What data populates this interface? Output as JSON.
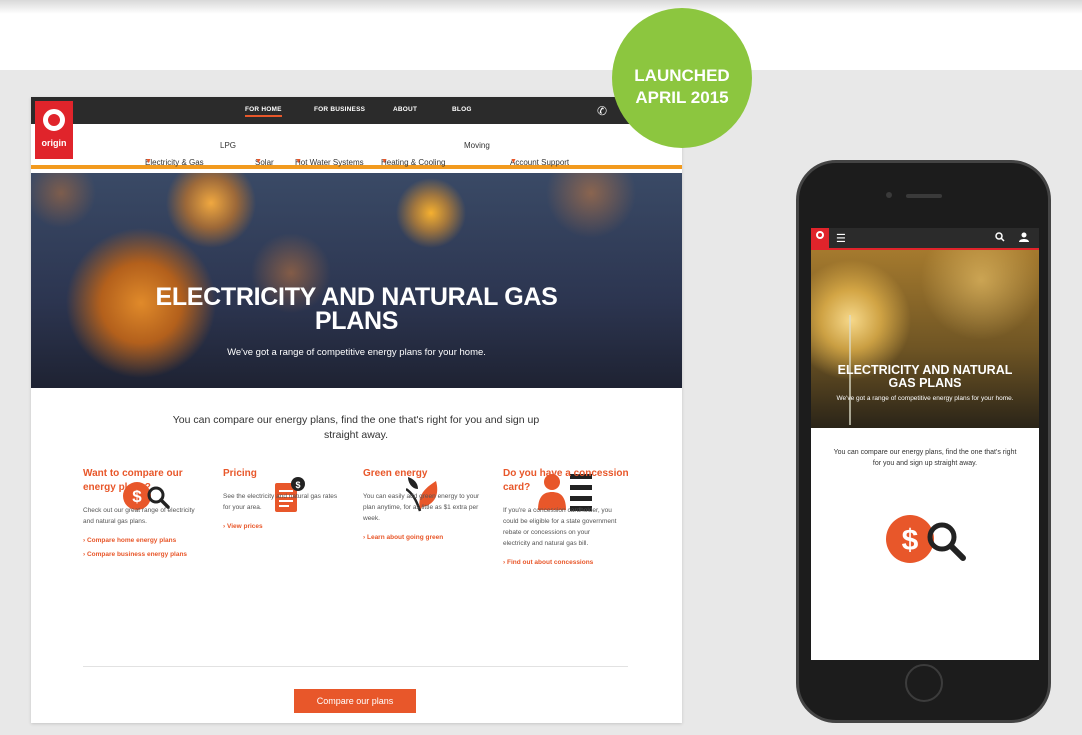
{
  "badge": {
    "line1": "LAUNCHED",
    "line2": "APRIL 2015"
  },
  "desktop": {
    "utility_nav": [
      "FOR HOME",
      "FOR BUSINESS",
      "ABOUT",
      "BLOG"
    ],
    "logo_text": "origin",
    "main_nav": [
      "Electricity & Gas",
      "LPG",
      "Solar",
      "Hot Water Systems",
      "Heating & Cooling",
      "Moving",
      "Account Support"
    ],
    "hero": {
      "title_line1": "ELECTRICITY AND NATURAL GAS",
      "title_line2": "PLANS",
      "subtitle": "We've got a range of competitive energy plans for your home."
    },
    "intro_line1": "You can compare our energy plans, find the one that's right for you and sign up",
    "intro_line2": "straight away.",
    "features": [
      {
        "icon": "dollar-search-icon",
        "title_line1": "Want to compare our",
        "title_line2": "energy plans?",
        "text_line1": "Check out our great range of electricity",
        "text_line2": "and natural gas plans.",
        "links": [
          "Compare home energy plans",
          "Compare business energy plans"
        ]
      },
      {
        "icon": "pricing-document-icon",
        "title_line1": "Pricing",
        "text_line1": "See the electricity and natural gas rates",
        "text_line2": "for your area.",
        "links": [
          "View prices"
        ]
      },
      {
        "icon": "leaf-icon",
        "title_line1": "Green energy",
        "text_line1": "You can easily add green energy to your",
        "text_line2": "plan anytime, for as little as $1 extra per",
        "text_line3": "week.",
        "links": [
          "Learn about going green"
        ]
      },
      {
        "icon": "concession-card-icon",
        "title_line1": "Do you have a concession",
        "title_line2": "card?",
        "text_line1": "If you're a concession cardholder, you",
        "text_line2": "could be eligible for a state government",
        "text_line3": "rebate or concessions on your",
        "text_line4": "electricity and natural gas bill.",
        "links": [
          "Find out about concessions"
        ]
      }
    ],
    "cta": "Compare our plans"
  },
  "mobile": {
    "hero_title_line1": "ELECTRICITY AND NATURAL",
    "hero_title_line2": "GAS PLANS",
    "hero_subtitle": "We've got a range of competitive energy plans for your home.",
    "intro_line1": "You can compare our energy plans, find the one that's right",
    "intro_line2": "for you and sign up straight away."
  },
  "colors": {
    "brand_orange": "#e8572a",
    "brand_red": "#e0242b",
    "badge_green": "#8cc63f",
    "nav_accent": "#f29a1e"
  }
}
